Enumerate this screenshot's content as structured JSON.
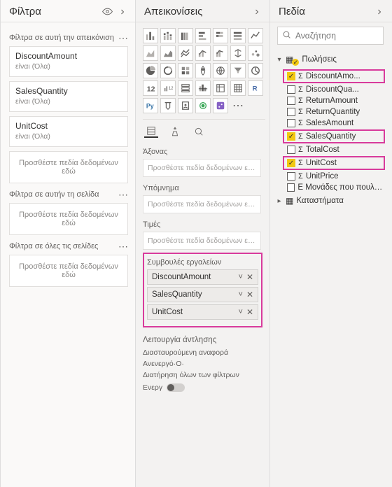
{
  "filters": {
    "title": "Φίλτρα",
    "sections": {
      "visual": {
        "label": "Φίλτρα σε αυτή την απεικόνιση",
        "cards": [
          {
            "name": "DiscountAmount",
            "value": "είναι (Όλα)"
          },
          {
            "name": "SalesQuantity",
            "value": "είναι (Όλα)"
          },
          {
            "name": "UnitCost",
            "value": "είναι (Όλα)"
          }
        ],
        "placeholder": "Προσθέστε πεδία δεδομένων εδώ"
      },
      "page": {
        "label": "Φίλτρα σε αυτήν τη σελίδα",
        "placeholder": "Προσθέστε πεδία δεδομένων εδώ"
      },
      "all": {
        "label": "Φίλτρα σε όλες τις σελίδες",
        "placeholder": "Προσθέστε πεδία δεδομένων εδώ"
      }
    }
  },
  "viz": {
    "title": "Απεικονίσεις",
    "wells": {
      "axis": {
        "label": "Άξονας",
        "placeholder": "Προσθέστε πεδία δεδομένων εδώ"
      },
      "legend": {
        "label": "Υπόμνημα",
        "placeholder": "Προσθέστε πεδία δεδομένων εδώ"
      },
      "values": {
        "label": "Τιμές",
        "placeholder": "Προσθέστε πεδία δεδομένων εδώ"
      },
      "tooltip": {
        "label": "Συμβουλές εργαλείων",
        "chips": [
          "DiscountAmount",
          "SalesQuantity",
          "UnitCost"
        ]
      }
    },
    "drill": {
      "header": "Λειτουργία άντλησης",
      "cross": "Διασταυρούμενη αναφορά",
      "off": "Ανενεργό·Ο·",
      "keep": "Διατήρηση όλων των φίλτρων",
      "toggleLabel": "Ενεργ"
    }
  },
  "fields": {
    "title": "Πεδία",
    "searchPlaceholder": "Αναζήτηση",
    "tables": [
      {
        "name": "Πωλήσεις",
        "expanded": true,
        "fields": [
          {
            "name": "DiscountAmo...",
            "checked": true,
            "hl": true,
            "sigma": true
          },
          {
            "name": "DiscountQua...",
            "checked": false,
            "hl": false,
            "sigma": true
          },
          {
            "name": "ReturnAmount",
            "checked": false,
            "hl": false,
            "sigma": true
          },
          {
            "name": "ReturnQuantity",
            "checked": false,
            "hl": false,
            "sigma": true
          },
          {
            "name": "SalesAmount",
            "checked": false,
            "hl": false,
            "sigma": true
          },
          {
            "name": "SalesQuantity",
            "checked": true,
            "hl": true,
            "sigma": true
          },
          {
            "name": "TotalCost",
            "checked": false,
            "hl": false,
            "sigma": true
          },
          {
            "name": "UnitCost",
            "checked": true,
            "hl": true,
            "sigma": true
          },
          {
            "name": "UnitPrice",
            "checked": false,
            "hl": false,
            "sigma": true
          }
        ],
        "extra": {
          "name": "Ε Μονάδες που πουλήθηκ",
          "checked": false
        }
      },
      {
        "name": "Καταστήματα",
        "expanded": false
      }
    ]
  }
}
